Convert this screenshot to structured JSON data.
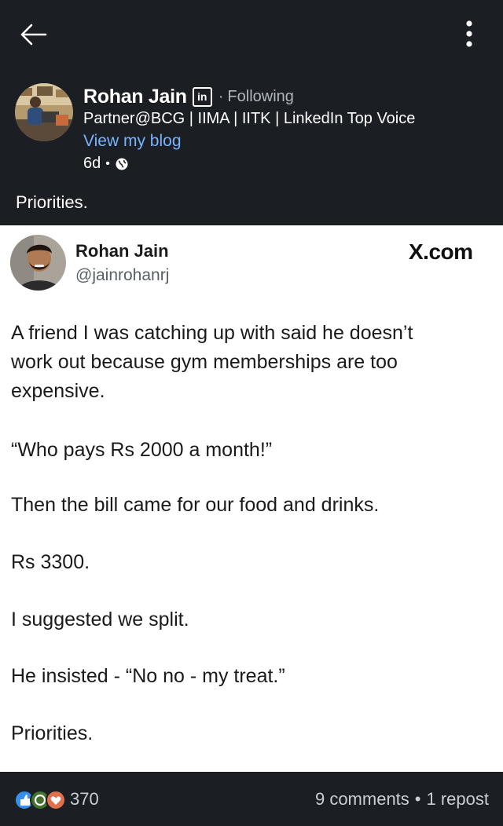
{
  "post": {
    "author_name": "Rohan Jain",
    "follow_status": "Following",
    "separator": "·",
    "headline": "Partner@BCG | IIMA | IITK | LinkedIn Top Voice",
    "blog_link": "View my blog",
    "age": "6d",
    "meta_separator": "•",
    "caption": "Priorities."
  },
  "embed": {
    "name": "Rohan Jain",
    "handle": "@jainrohanrj",
    "source": "X.com",
    "lines": [
      "A friend I was catching up with said he doesn’t",
      "work out because gym memberships are too",
      "expensive.",
      "“Who pays Rs 2000 a month!”",
      "Then the bill came for our food and drinks.",
      "Rs 3300.",
      "I suggested we split.",
      "He insisted - “No no - my treat.”",
      "Priorities."
    ]
  },
  "footer": {
    "reaction_icons": [
      "like-icon",
      "celebrate-icon",
      "love-icon"
    ],
    "reaction_count": "370",
    "comments": "9 comments",
    "separator": "•",
    "reposts": "1 repost"
  },
  "colors": {
    "background": "#1b1f23",
    "link": "#78b3ff",
    "like": "#378fe9",
    "celebrate": "#44712e",
    "love": "#df704d"
  }
}
